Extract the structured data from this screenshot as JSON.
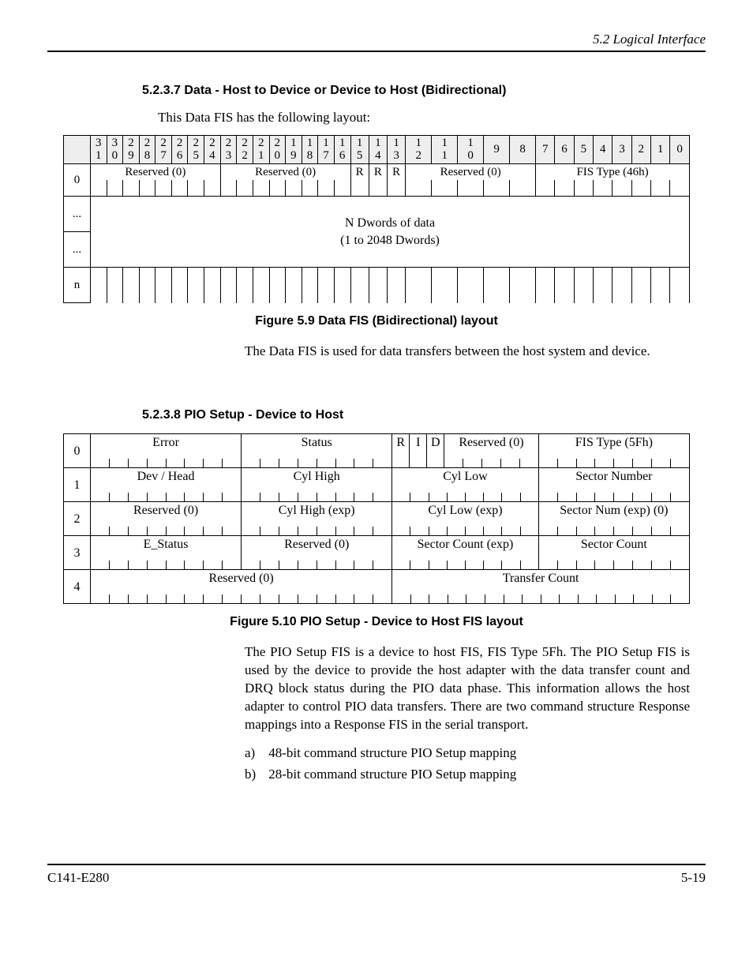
{
  "header": {
    "section": "5.2  Logical Interface"
  },
  "s537": {
    "title": "5.2.3.7  Data - Host to Device or Device to Host (Bidirectional)",
    "intro": "This Data FIS has the following layout:",
    "bits": [
      "31",
      "30",
      "29",
      "28",
      "27",
      "26",
      "25",
      "24",
      "23",
      "22",
      "21",
      "20",
      "19",
      "18",
      "17",
      "16",
      "15",
      "14",
      "13",
      "12",
      "11",
      "10",
      "9",
      "8",
      "7",
      "6",
      "5",
      "4",
      "3",
      "2",
      "1",
      "0"
    ],
    "row0": {
      "label": "0",
      "a": "Reserved (0)",
      "b": "Reserved (0)",
      "c1": "R",
      "c2": "R",
      "c3": "R",
      "c4": "Reserved (0)",
      "d": "FIS Type (46h)"
    },
    "dots": "...",
    "data_l1": "N Dwords of data",
    "data_l2": "(1 to 2048 Dwords)",
    "rown": "n",
    "caption": "Figure 5.9  Data FIS (Bidirectional) layout",
    "after": "The Data FIS is used for data transfers between the host system and device."
  },
  "s538": {
    "title": "5.2.3.8  PIO Setup - Device to Host",
    "rows": [
      {
        "label": "0",
        "cells": [
          {
            "span": 8,
            "text": "Error"
          },
          {
            "span": 8,
            "text": "Status"
          },
          {
            "span": 1,
            "text": "R",
            "slim": true
          },
          {
            "span": 1,
            "text": "I",
            "slim": true
          },
          {
            "span": 1,
            "text": "D",
            "slim": true
          },
          {
            "span": 5,
            "text": "Reserved (0)"
          },
          {
            "span": 8,
            "text": "FIS Type (5Fh)"
          }
        ]
      },
      {
        "label": "1",
        "cells": [
          {
            "span": 8,
            "text": "Dev / Head"
          },
          {
            "span": 8,
            "text": "Cyl High"
          },
          {
            "span": 8,
            "text": "Cyl Low"
          },
          {
            "span": 8,
            "text": "Sector Number"
          }
        ]
      },
      {
        "label": "2",
        "cells": [
          {
            "span": 8,
            "text": "Reserved (0)"
          },
          {
            "span": 8,
            "text": "Cyl High (exp)"
          },
          {
            "span": 8,
            "text": "Cyl Low (exp)"
          },
          {
            "span": 8,
            "text": "Sector Num (exp) (0)"
          }
        ]
      },
      {
        "label": "3",
        "cells": [
          {
            "span": 8,
            "text": "E_Status"
          },
          {
            "span": 8,
            "text": "Reserved (0)"
          },
          {
            "span": 8,
            "text": "Sector Count (exp)"
          },
          {
            "span": 8,
            "text": "Sector Count"
          }
        ]
      },
      {
        "label": "4",
        "cells": [
          {
            "span": 16,
            "text": "Reserved (0)"
          },
          {
            "span": 16,
            "text": "Transfer Count"
          }
        ]
      }
    ],
    "caption": "Figure 5.10  PIO Setup - Device to Host FIS layout",
    "para": "The PIO Setup FIS is a device to host FIS, FIS Type 5Fh. The PIO Setup FIS is used by the device to provide the host adapter with the data transfer count and DRQ block status during the PIO data phase. This information allows the host adapter to control PIO data transfers. There are two command structure Response mappings into a Response FIS in the serial transport.",
    "list": [
      {
        "k": "a)",
        "v": "48-bit command structure PIO Setup mapping"
      },
      {
        "k": "b)",
        "v": "28-bit command structure PIO Setup mapping"
      }
    ]
  },
  "footer": {
    "left": "C141-E280",
    "right": "5-19"
  }
}
